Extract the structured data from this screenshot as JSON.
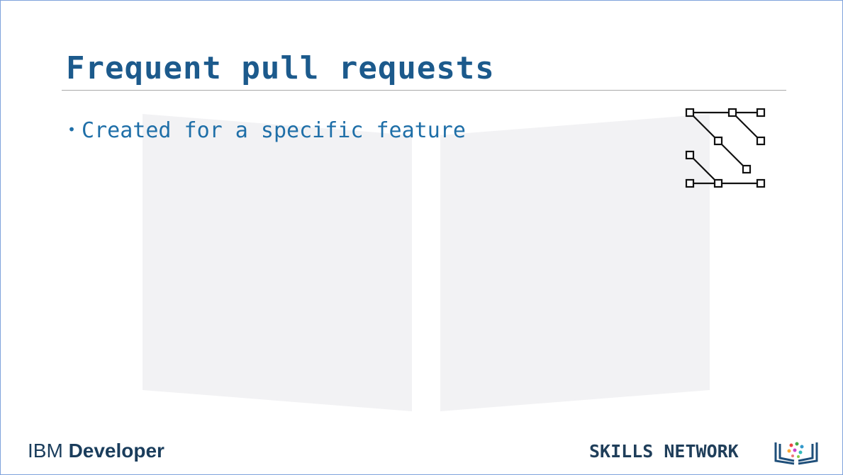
{
  "slide": {
    "title": "Frequent pull requests",
    "bullets": [
      {
        "text": "Created for a specific feature"
      }
    ],
    "bullet_glyph": "•",
    "icon": "branch-graph-icon",
    "footer_left": {
      "prefix": "IBM",
      "bold": "Developer"
    },
    "footer_right": {
      "text": "SKILLS NETWORK",
      "logo": "skills-network-book-icon"
    },
    "colors": {
      "title": "#1c5a8c",
      "bullet": "#1f6fa8",
      "border": "#7fa2dc"
    }
  }
}
